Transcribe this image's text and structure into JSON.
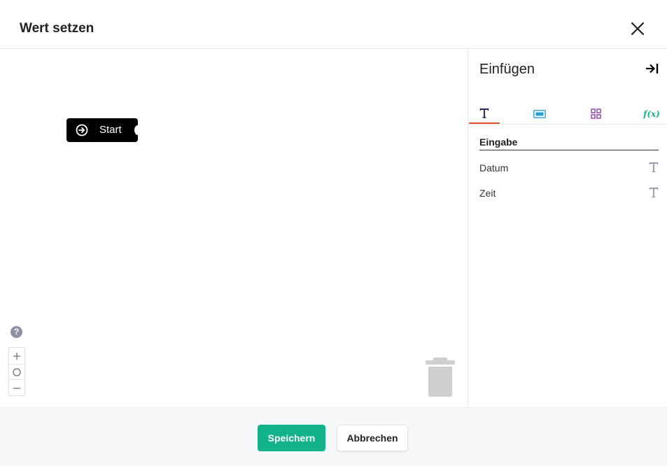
{
  "dialog": {
    "title": "Wert setzen",
    "close_icon": "close-icon"
  },
  "workspace": {
    "start_block": {
      "label": "Start",
      "icon": "arrow-circle-right-icon",
      "color": "#000000"
    },
    "help": {
      "symbol": "?",
      "icon": "help-icon"
    },
    "zoom": {
      "in_icon": "plus-icon",
      "reset_icon": "circle-icon",
      "out_icon": "minus-icon"
    },
    "trash_icon": "trash-icon"
  },
  "sidebar": {
    "title": "Einfügen",
    "collapse_icon": "arrow-to-right-icon",
    "tabs": [
      {
        "icon": "text-type-icon",
        "active": true,
        "color": "#2d2d5a"
      },
      {
        "icon": "ab-field-icon",
        "active": false,
        "color": "#2a9fd6"
      },
      {
        "icon": "grid-icon",
        "active": false,
        "color": "#8e3aa6"
      },
      {
        "label": "f(x)",
        "icon": "function-icon",
        "active": false,
        "color": "#1aaf8b"
      }
    ],
    "section": {
      "title": "Eingabe",
      "items": [
        {
          "label": "Datum",
          "type_icon": "text-type-icon"
        },
        {
          "label": "Zeit",
          "type_icon": "text-type-icon"
        }
      ]
    }
  },
  "footer": {
    "save_label": "Speichern",
    "cancel_label": "Abbrechen",
    "save_color": "#12b28a"
  }
}
